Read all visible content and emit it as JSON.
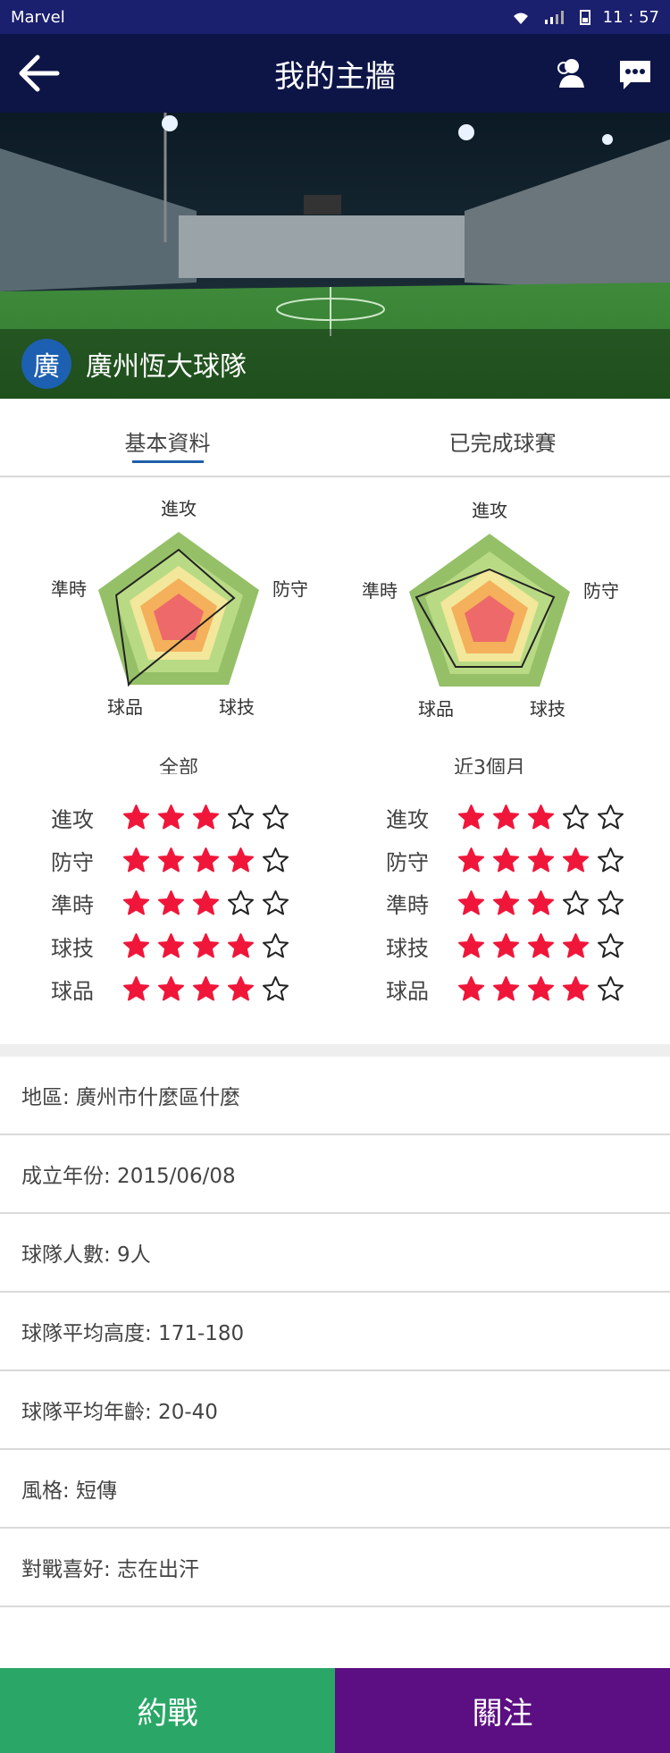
{
  "status": {
    "carrier": "Marvel",
    "time": "11 : 57"
  },
  "header": {
    "title": "我的主牆"
  },
  "team": {
    "avatar_char": "廣",
    "name": "廣州恆大球隊"
  },
  "tabs": [
    {
      "label": "基本資料",
      "active": true
    },
    {
      "label": "已完成球賽",
      "active": false
    }
  ],
  "radar": {
    "axis_labels": [
      "進攻",
      "防守",
      "球技",
      "球品",
      "準時"
    ],
    "charts": [
      {
        "title": "全部"
      },
      {
        "title": "近3個月"
      }
    ]
  },
  "ratings": {
    "labels": [
      "進攻",
      "防守",
      "準時",
      "球技",
      "球品"
    ],
    "all": [
      3,
      4,
      3,
      4,
      4
    ],
    "recent": [
      3,
      4,
      3,
      4,
      4
    ],
    "max": 5
  },
  "info": [
    "地區: 廣州市什麼區什麼",
    "成立年份:  2015/06/08",
    "球隊人數:  9人",
    "球隊平均高度:  171-180",
    "球隊平均年齡:  20-40",
    "風格:  短傳",
    "對戰喜好: 志在出汗"
  ],
  "buttons": {
    "challenge": "約戰",
    "follow": "關注"
  },
  "colors": {
    "appbar": "#0d1547",
    "star": "#f0163a",
    "challenge": "#2aa767",
    "follow": "#5c0f82"
  }
}
